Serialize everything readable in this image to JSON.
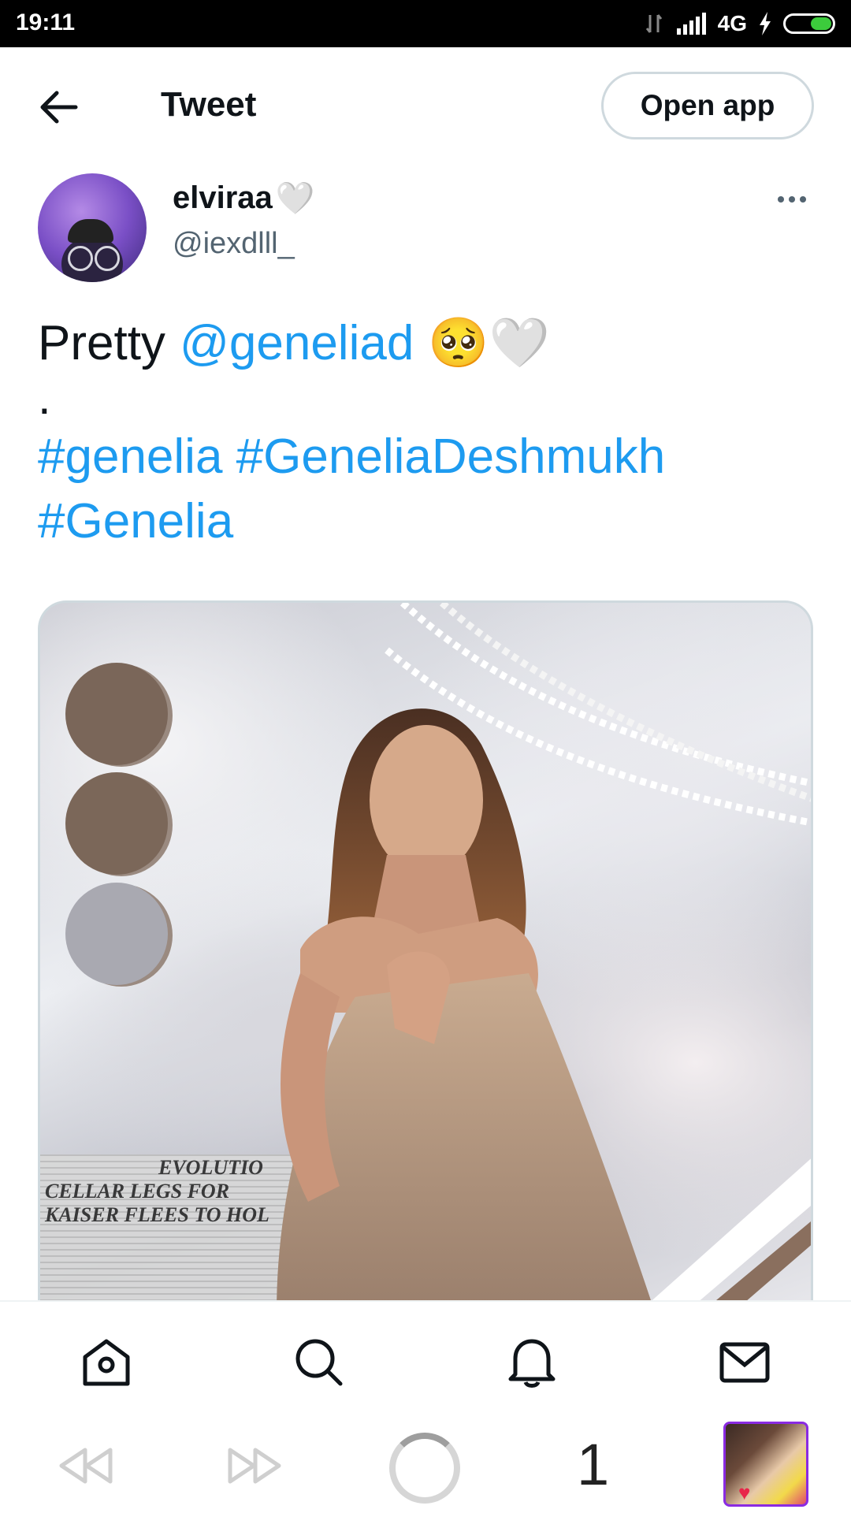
{
  "status_bar": {
    "time": "19:11",
    "network": "4G"
  },
  "header": {
    "title": "Tweet",
    "open_app_label": "Open app"
  },
  "author": {
    "display_name": "elviraa",
    "display_name_emoji": "🤍",
    "handle": "@iexdlll_"
  },
  "tweet": {
    "text_prefix": "Pretty",
    "mention": "@geneliad",
    "emojis": "🥺🤍",
    "dot": ".",
    "hashtags": [
      "#genelia",
      "#GeneliaDeshmukh",
      "#Genelia"
    ]
  },
  "media": {
    "newspaper_headline_1": "EVOLUTIO",
    "newspaper_headline_2": "CELLAR LEGS FOR",
    "newspaper_headline_3": "KAISER FLEES TO HOL"
  },
  "bottom_nav": [
    "home-icon",
    "search-icon",
    "notifications-icon",
    "messages-icon"
  ],
  "system_nav": {
    "tab_count": "1"
  },
  "colors": {
    "accent": "#1d9bf0",
    "text": "#0f1419",
    "secondary": "#536471",
    "border": "#cfd9de"
  }
}
